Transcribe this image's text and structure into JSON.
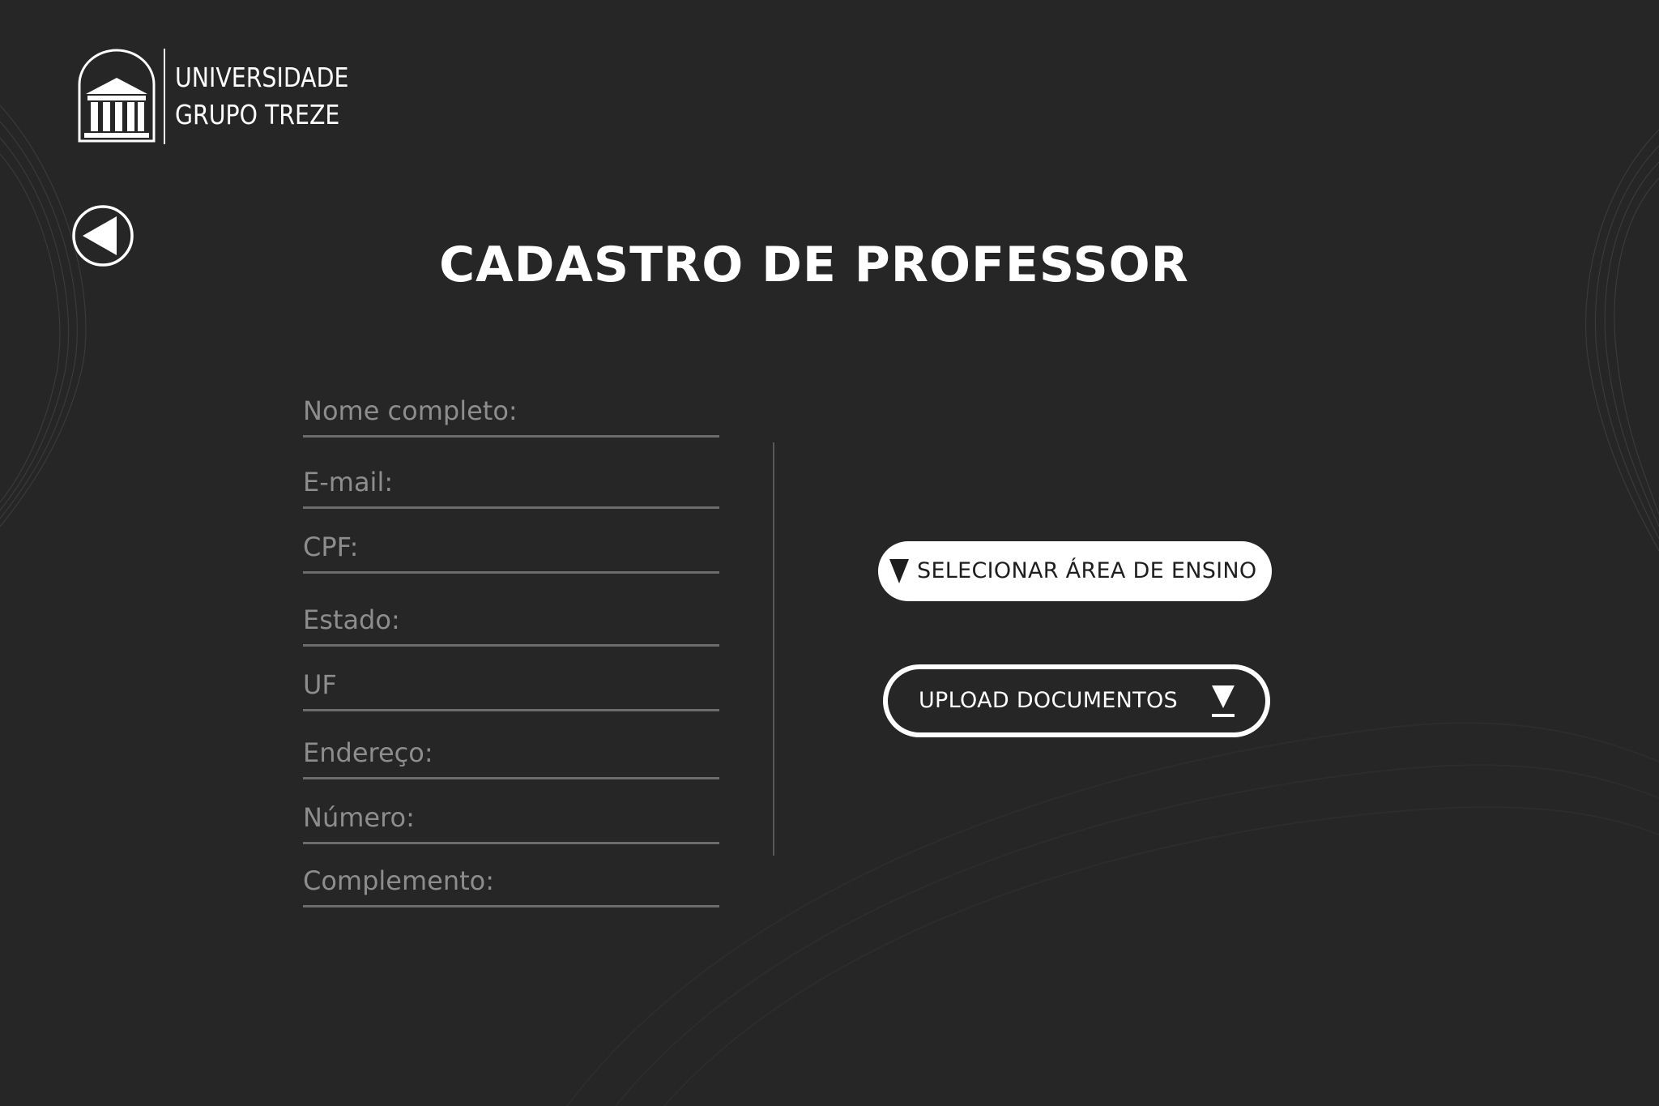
{
  "logo": {
    "line1": "UNIVERSIDADE",
    "line2": "GRUPO TREZE",
    "icon": "university-building-icon"
  },
  "nav": {
    "back_icon": "back-arrow-icon"
  },
  "page": {
    "title": "CADASTRO DE PROFESSOR"
  },
  "form": {
    "fields": [
      {
        "label": "Nome completo:",
        "value": ""
      },
      {
        "label": "E-mail:",
        "value": ""
      },
      {
        "label": "CPF:",
        "value": ""
      },
      {
        "label": "Estado:",
        "value": ""
      },
      {
        "label": "UF",
        "value": ""
      },
      {
        "label": "Endereço:",
        "value": ""
      },
      {
        "label": "Número:",
        "value": ""
      },
      {
        "label": "Complemento:",
        "value": ""
      }
    ]
  },
  "actions": {
    "select_area_label": "SELECIONAR ÁREA DE ENSINO",
    "select_area_icon": "triangle-down-icon",
    "upload_label": "UPLOAD DOCUMENTOS",
    "upload_icon": "download-arrow-icon"
  },
  "colors": {
    "background": "#262626",
    "text": "#ffffff",
    "placeholder": "#8d8d8d",
    "underline": "#6c6c6c",
    "button_fill": "#ffffff",
    "button_text_dark": "#1e1e1e"
  }
}
